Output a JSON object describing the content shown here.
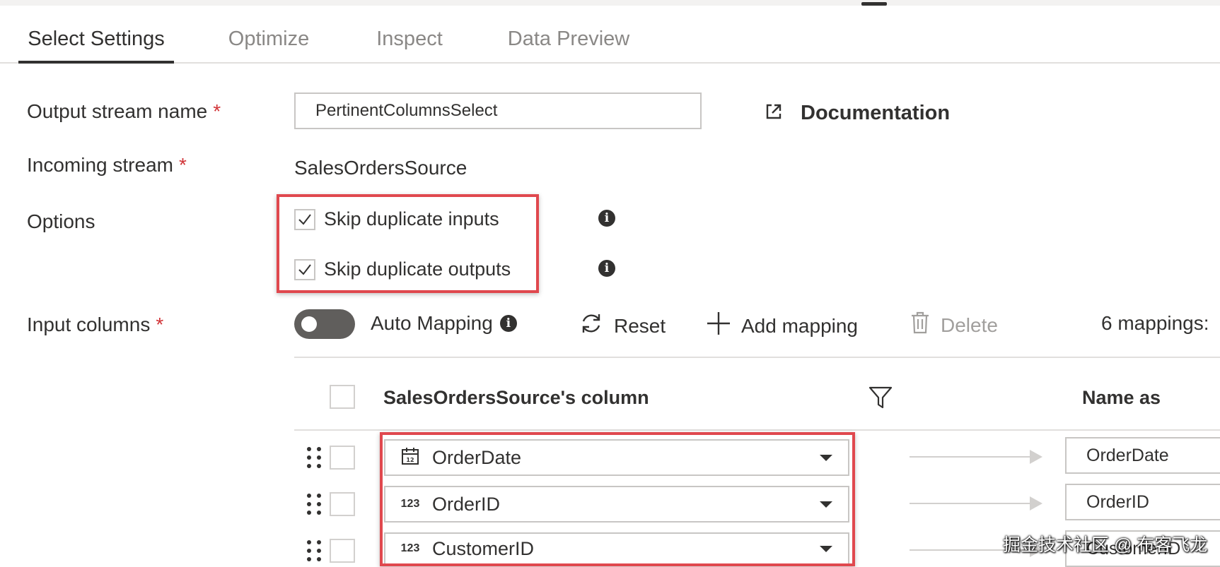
{
  "tabs": [
    {
      "label": "Select Settings"
    },
    {
      "label": "Optimize"
    },
    {
      "label": "Inspect"
    },
    {
      "label": "Data Preview"
    }
  ],
  "form": {
    "output_stream": {
      "label": "Output stream name",
      "required_mark": "*",
      "value": "PertinentColumnsSelect"
    },
    "documentation": {
      "label": "Documentation",
      "icon": "open-external-icon"
    },
    "incoming_stream": {
      "label": "Incoming stream",
      "required_mark": "*",
      "value": "SalesOrdersSource"
    },
    "options": {
      "label": "Options",
      "items": [
        {
          "label": "Skip duplicate inputs",
          "checked": true,
          "info_icon": "i"
        },
        {
          "label": "Skip duplicate outputs",
          "checked": true,
          "info_icon": "i"
        }
      ]
    },
    "input_columns": {
      "label": "Input columns",
      "required_mark": "*"
    }
  },
  "toolbar": {
    "auto_mapping": {
      "label": "Auto Mapping",
      "enabled": false,
      "info_icon": "i"
    },
    "reset": {
      "label": "Reset",
      "icon": "refresh-icon"
    },
    "add_mapping": {
      "label": "Add mapping",
      "icon": "plus-icon"
    },
    "delete": {
      "label": "Delete",
      "icon": "trash-icon",
      "disabled": true
    },
    "mappings_count": "6 mappings:"
  },
  "grid": {
    "column_header": "SalesOrdersSource's column",
    "name_as_header": "Name as",
    "rows": [
      {
        "type": "date",
        "type_glyph": "12",
        "column": "OrderDate",
        "name_as": "OrderDate"
      },
      {
        "type": "number",
        "type_glyph": "123",
        "column": "OrderID",
        "name_as": "OrderID"
      },
      {
        "type": "number",
        "type_glyph": "123",
        "column": "CustomerID",
        "name_as": "CustomerID"
      }
    ]
  },
  "watermark": "掘金技术社区 @ 布客飞龙",
  "colors": {
    "highlight": "#e0484e",
    "required": "#d13438",
    "text": "#323130",
    "muted": "#8a8886",
    "toggle_off": "#605e5c"
  }
}
